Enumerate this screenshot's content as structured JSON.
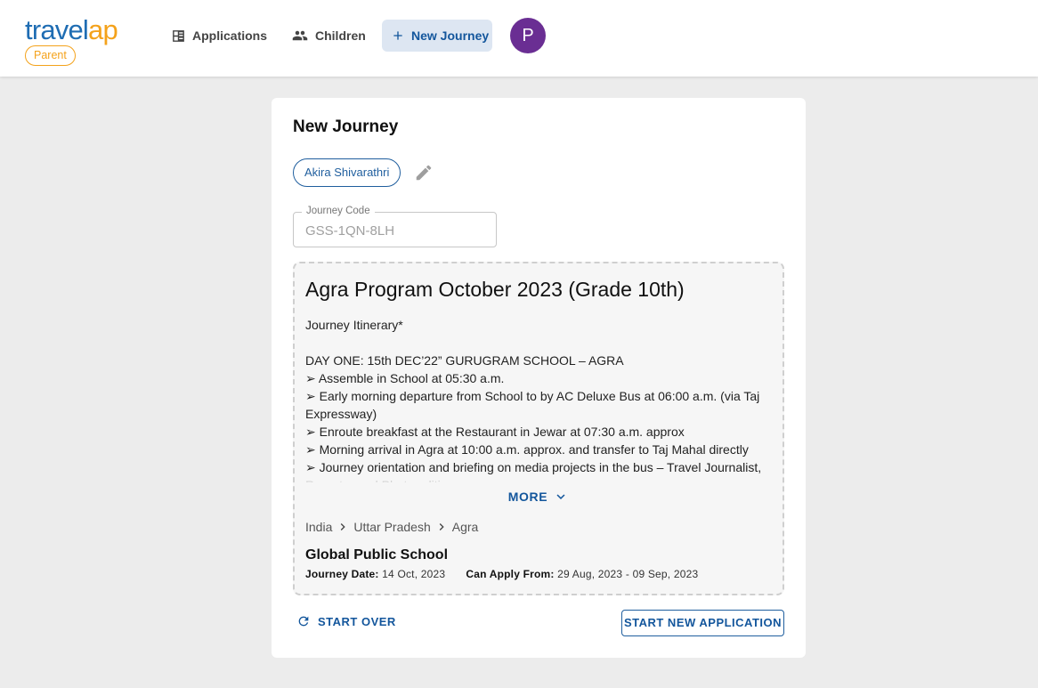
{
  "brand": {
    "logo_part1": "travel",
    "logo_part2": "ap",
    "role_badge": "Parent",
    "colors": {
      "primary": "#1f6db3",
      "accent": "#f4a21b"
    }
  },
  "nav": {
    "applications": "Applications",
    "children": "Children",
    "new_journey": "New Journey",
    "avatar_initial": "P"
  },
  "card": {
    "title": "New Journey",
    "child_chip": "Akira Shivarathri",
    "journey_code_label": "Journey Code",
    "journey_code_value": "GSS-1QN-8LH"
  },
  "journey": {
    "title": "Agra Program October 2023 (Grade 10th)",
    "itinerary_lines": [
      "Journey Itinerary*",
      "",
      "DAY ONE: 15th DEC’22” GURUGRAM SCHOOL – AGRA",
      "➢    Assemble in School at 05:30 a.m.",
      "➢    Early morning departure from School to by AC Deluxe Bus at 06:00 a.m. (via Taj Expressway)",
      "➢    Enroute breakfast at the Restaurant in Jewar at 07:30 a.m. approx",
      "➢    Morning arrival in Agra at 10:00 a.m. approx. and transfer to Taj Mahal directly",
      "➢    Journey orientation and briefing on media projects in the bus – Travel Journalist, Reporter and Photo editing"
    ],
    "more_label": "MORE",
    "location": {
      "country": "India",
      "state": "Uttar Pradesh",
      "city": "Agra"
    },
    "school": "Global Public School",
    "journey_date_label": "Journey Date:",
    "journey_date": "14 Oct, 2023",
    "apply_label": "Can Apply From:",
    "apply_range": "29 Aug, 2023 - 09 Sep, 2023"
  },
  "actions": {
    "start_over": "START OVER",
    "start_new": "START NEW APPLICATION"
  },
  "icons": [
    "applications-icon",
    "children-icon",
    "plus-icon",
    "pencil-icon",
    "chevron-down-icon",
    "chevron-right-icon",
    "refresh-icon"
  ]
}
